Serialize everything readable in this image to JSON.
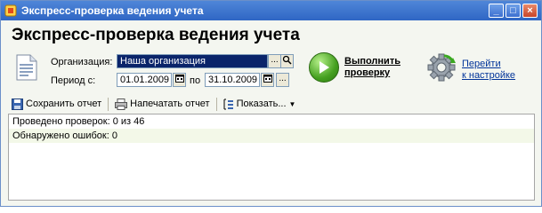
{
  "window": {
    "title": "Экспресс-проверка ведения учета",
    "buttons": {
      "minimize": "_",
      "maximize": "□",
      "close": "×"
    }
  },
  "heading": "Экспресс-проверка ведения учета",
  "form": {
    "org_label": "Организация:",
    "org_value": "Наша организация",
    "period_label": "Период с:",
    "date_from": "01.01.2009",
    "to_label": "по",
    "date_to": "31.10.2009",
    "ellipsis": "..."
  },
  "actions": {
    "run_line1": "Выполнить",
    "run_line2": "проверку",
    "settings_line1": "Перейти",
    "settings_line2": "к настройке"
  },
  "toolbar": {
    "save": "Сохранить отчет",
    "print": "Напечатать отчет",
    "show": "Показать..."
  },
  "report": {
    "rows": [
      "Проведено проверок: 0 из 46",
      "Обнаружено ошибок: 0"
    ]
  },
  "colors": {
    "titlebar": "#2f66c4",
    "selection": "#0a246a",
    "accent_green": "#45a020"
  }
}
